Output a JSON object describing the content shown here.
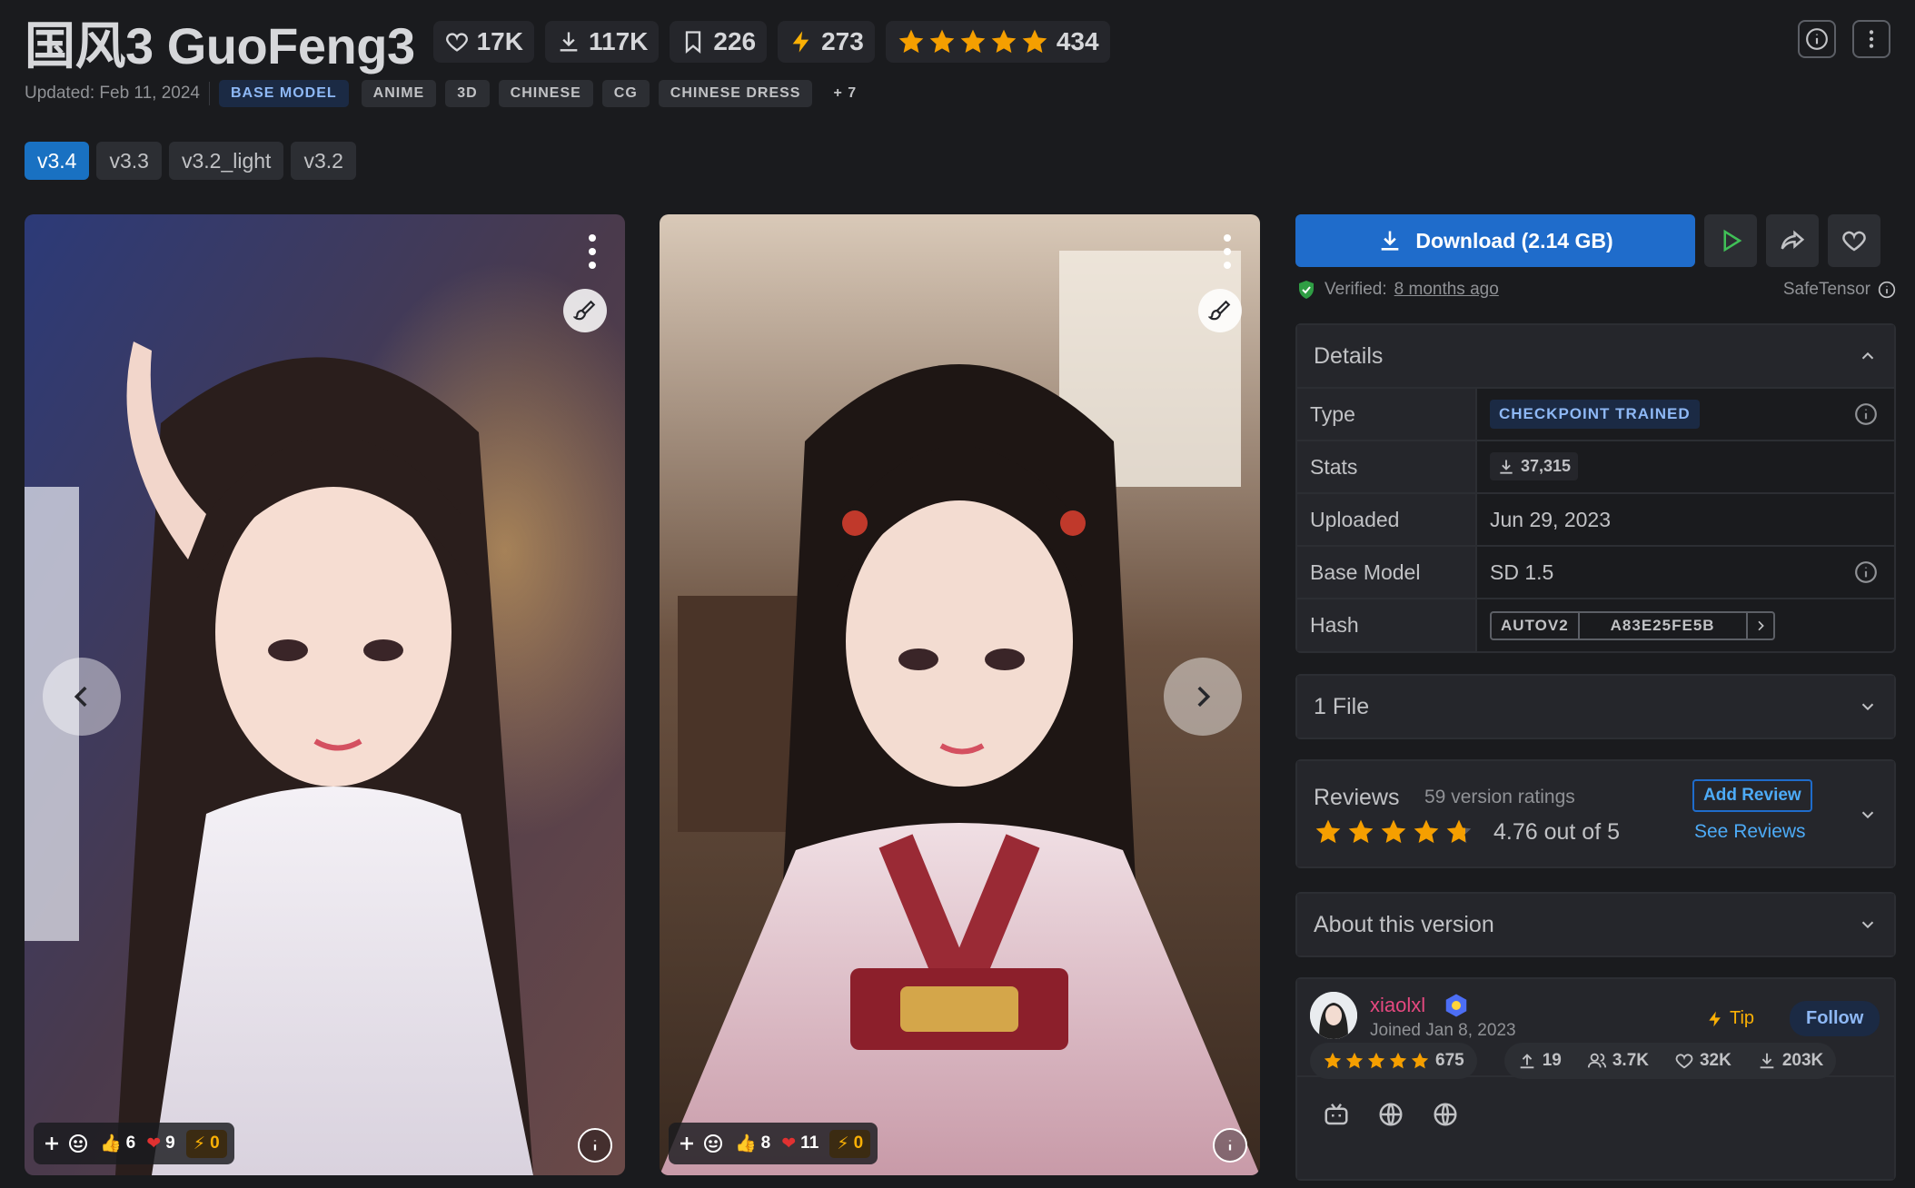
{
  "model": {
    "title": "国风3 GuoFeng3",
    "stats": {
      "likes": "17K",
      "downloads": "117K",
      "bookmarks": "226",
      "buzz": "273",
      "rating_count": "434",
      "rating_stars": 5
    },
    "updated": "Updated: Feb 11, 2024",
    "base_tag": "BASE MODEL",
    "tags": [
      "ANIME",
      "3D",
      "CHINESE",
      "CG",
      "CHINESE DRESS",
      "+ 7"
    ]
  },
  "versions": [
    {
      "label": "v3.4",
      "active": true
    },
    {
      "label": "v3.3",
      "active": false
    },
    {
      "label": "v3.2_light",
      "active": false
    },
    {
      "label": "v3.2",
      "active": false
    }
  ],
  "images": [
    {
      "reactions": {
        "like": "6",
        "heart": "9",
        "buzz": "0"
      }
    },
    {
      "reactions": {
        "like": "8",
        "heart": "11",
        "buzz": "0"
      }
    }
  ],
  "download": {
    "label": "Download (2.14 GB)",
    "verified_prefix": "Verified:",
    "verified_time": "8 months ago",
    "format": "SafeTensor"
  },
  "details": {
    "title": "Details",
    "type_label": "Type",
    "type_value": "CHECKPOINT TRAINED",
    "stats_label": "Stats",
    "stats_value": "37,315",
    "uploaded_label": "Uploaded",
    "uploaded_value": "Jun 29, 2023",
    "base_label": "Base Model",
    "base_value": "SD 1.5",
    "hash_label": "Hash",
    "hash_type": "AUTOV2",
    "hash_value": "A83E25FE5B"
  },
  "files": {
    "title": "1 File"
  },
  "reviews": {
    "title": "Reviews",
    "count": "59 version ratings",
    "score": "4.76 out of 5",
    "add": "Add Review",
    "see": "See Reviews",
    "stars": 4.76
  },
  "about": {
    "title": "About this version"
  },
  "creator": {
    "name": "xiaolxl",
    "joined": "Joined Jan 8, 2023",
    "tip": "Tip",
    "follow": "Follow",
    "rating_count": "675",
    "uploads": "19",
    "followers": "3.7K",
    "likes": "32K",
    "downloads": "203K"
  },
  "colors": {
    "accent": "#1f6ccb",
    "star": "#f59f00",
    "creator": "#e64980"
  }
}
